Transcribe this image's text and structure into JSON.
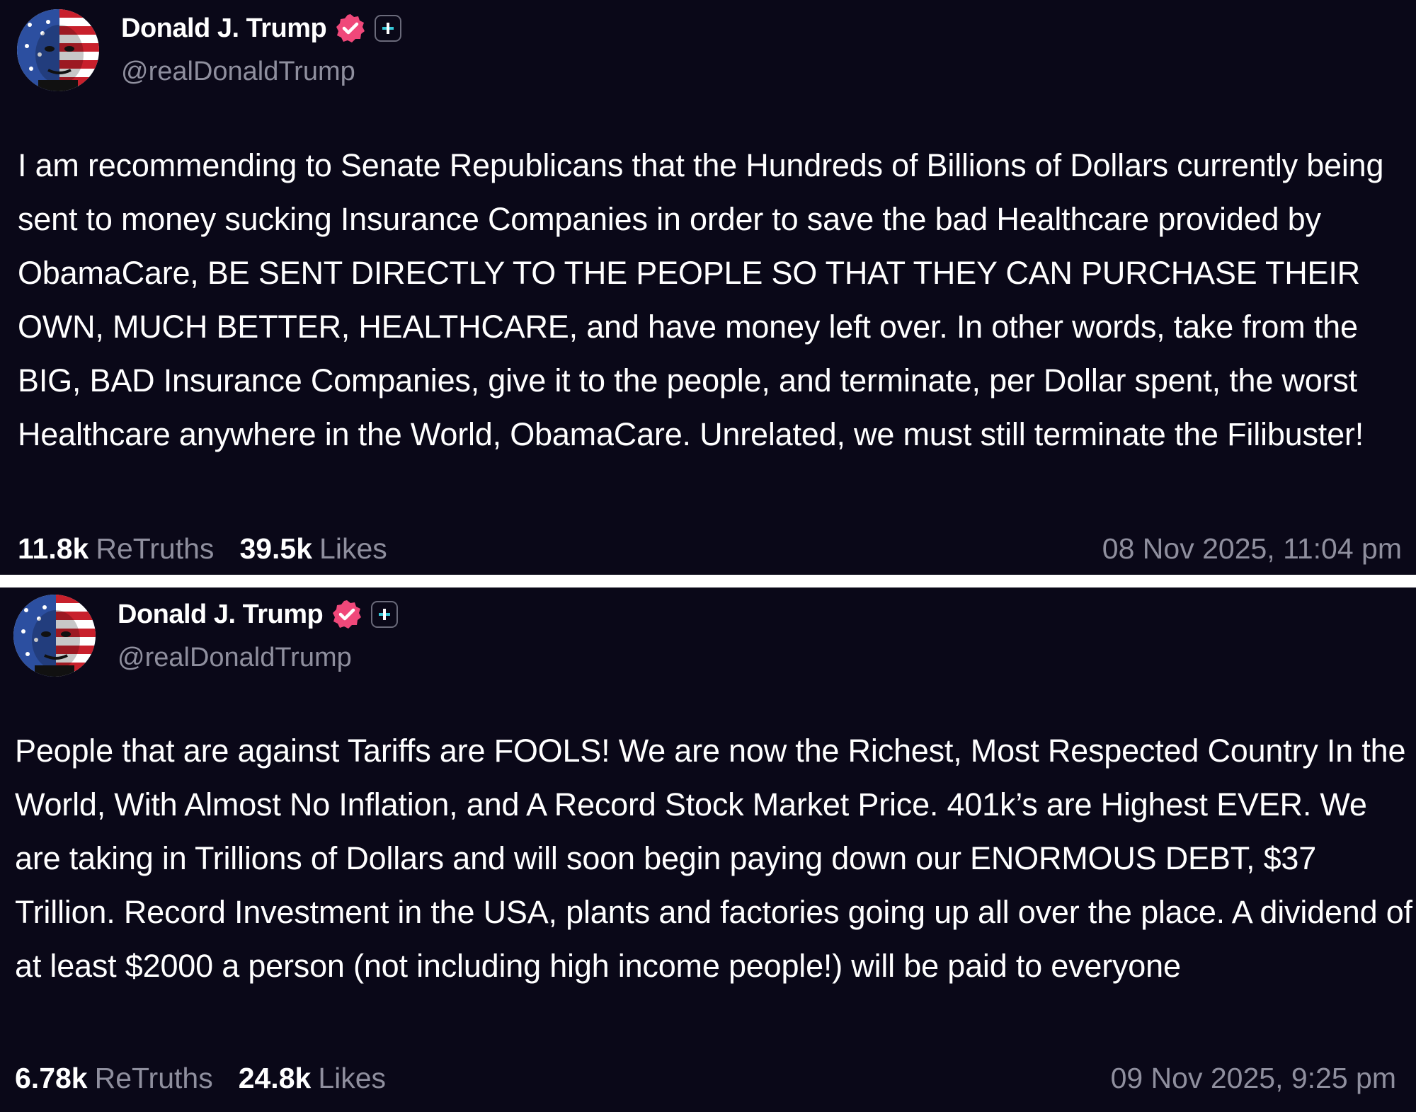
{
  "posts": [
    {
      "author": {
        "name": "Donald J. Trump",
        "handle": "@realDonaldTrump"
      },
      "body": "I am recommending to Senate Republicans that the Hundreds of Billions of Dollars currently being sent to money sucking Insurance Companies in order to save the bad Healthcare provided by ObamaCare, BE SENT DIRECTLY TO THE PEOPLE SO THAT THEY CAN PURCHASE THEIR OWN, MUCH BETTER, HEALTHCARE, and have money left over. In other words, take from the BIG, BAD Insurance Companies, give it to the people, and terminate, per Dollar spent, the worst Healthcare anywhere in the World, ObamaCare. Unrelated, we must still terminate the Filibuster!",
      "retruths_count": "11.8k",
      "retruths_label": "ReTruths",
      "likes_count": "39.5k",
      "likes_label": "Likes",
      "timestamp": "08 Nov 2025, 11:04 pm"
    },
    {
      "author": {
        "name": "Donald J. Trump",
        "handle": "@realDonaldTrump"
      },
      "body": "People that are against Tariffs are FOOLS! We are now the Richest, Most Respected Country In the World, With Almost No Inflation, and A Record Stock Market Price. 401k’s are Highest EVER. We are taking in Trillions of Dollars and will soon begin paying down our ENORMOUS DEBT, $37 Trillion. Record Investment in the USA, plants and factories going up all over the place. A dividend of at least $2000 a person (not including high income people!) will be paid to everyone",
      "retruths_count": "6.78k",
      "retruths_label": "ReTruths",
      "likes_count": "24.8k",
      "likes_label": "Likes",
      "timestamp": "09 Nov 2025, 9:25 pm"
    }
  ],
  "icons": {
    "verified": "verified-badge-icon",
    "plus": "plus-icon",
    "avatar": "flag-face-avatar"
  },
  "colors": {
    "background": "#0a0818",
    "text": "#ffffff",
    "muted": "#8f8f9e",
    "verified_badge": "#f0487a",
    "plus_accent": "#35c8d8",
    "divider": "#ffffff"
  }
}
